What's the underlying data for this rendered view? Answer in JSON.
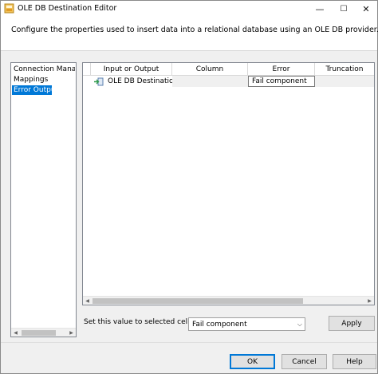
{
  "window": {
    "title": "OLE DB Destination Editor",
    "minimize_glyph": "—",
    "maximize_glyph": "☐",
    "close_glyph": "✕"
  },
  "description": "Configure the properties used to insert data into a relational database using an OLE DB provider.",
  "nav": {
    "items": [
      {
        "label": "Connection Manager",
        "selected": false
      },
      {
        "label": "Mappings",
        "selected": false
      },
      {
        "label": "Error Output",
        "selected": true
      }
    ]
  },
  "grid": {
    "columns": [
      "Input or Output",
      "Column",
      "Error",
      "Truncation"
    ],
    "rows": [
      {
        "input_or_output": "OLE DB Destination...",
        "column": "",
        "error": "Fail component",
        "truncation": "",
        "icon": "input-icon"
      }
    ]
  },
  "set_value": {
    "label": "Set this value to selected cells:",
    "selected": "Fail component"
  },
  "buttons": {
    "apply": "Apply",
    "ok": "OK",
    "cancel": "Cancel",
    "help": "Help"
  },
  "scroll_arrows": {
    "left": "◀",
    "right": "▶",
    "dropdown": "⌵"
  },
  "colors": {
    "selection": "#0078d7",
    "window_bg": "#f0f0f0",
    "button_bg": "#e1e1e1"
  }
}
